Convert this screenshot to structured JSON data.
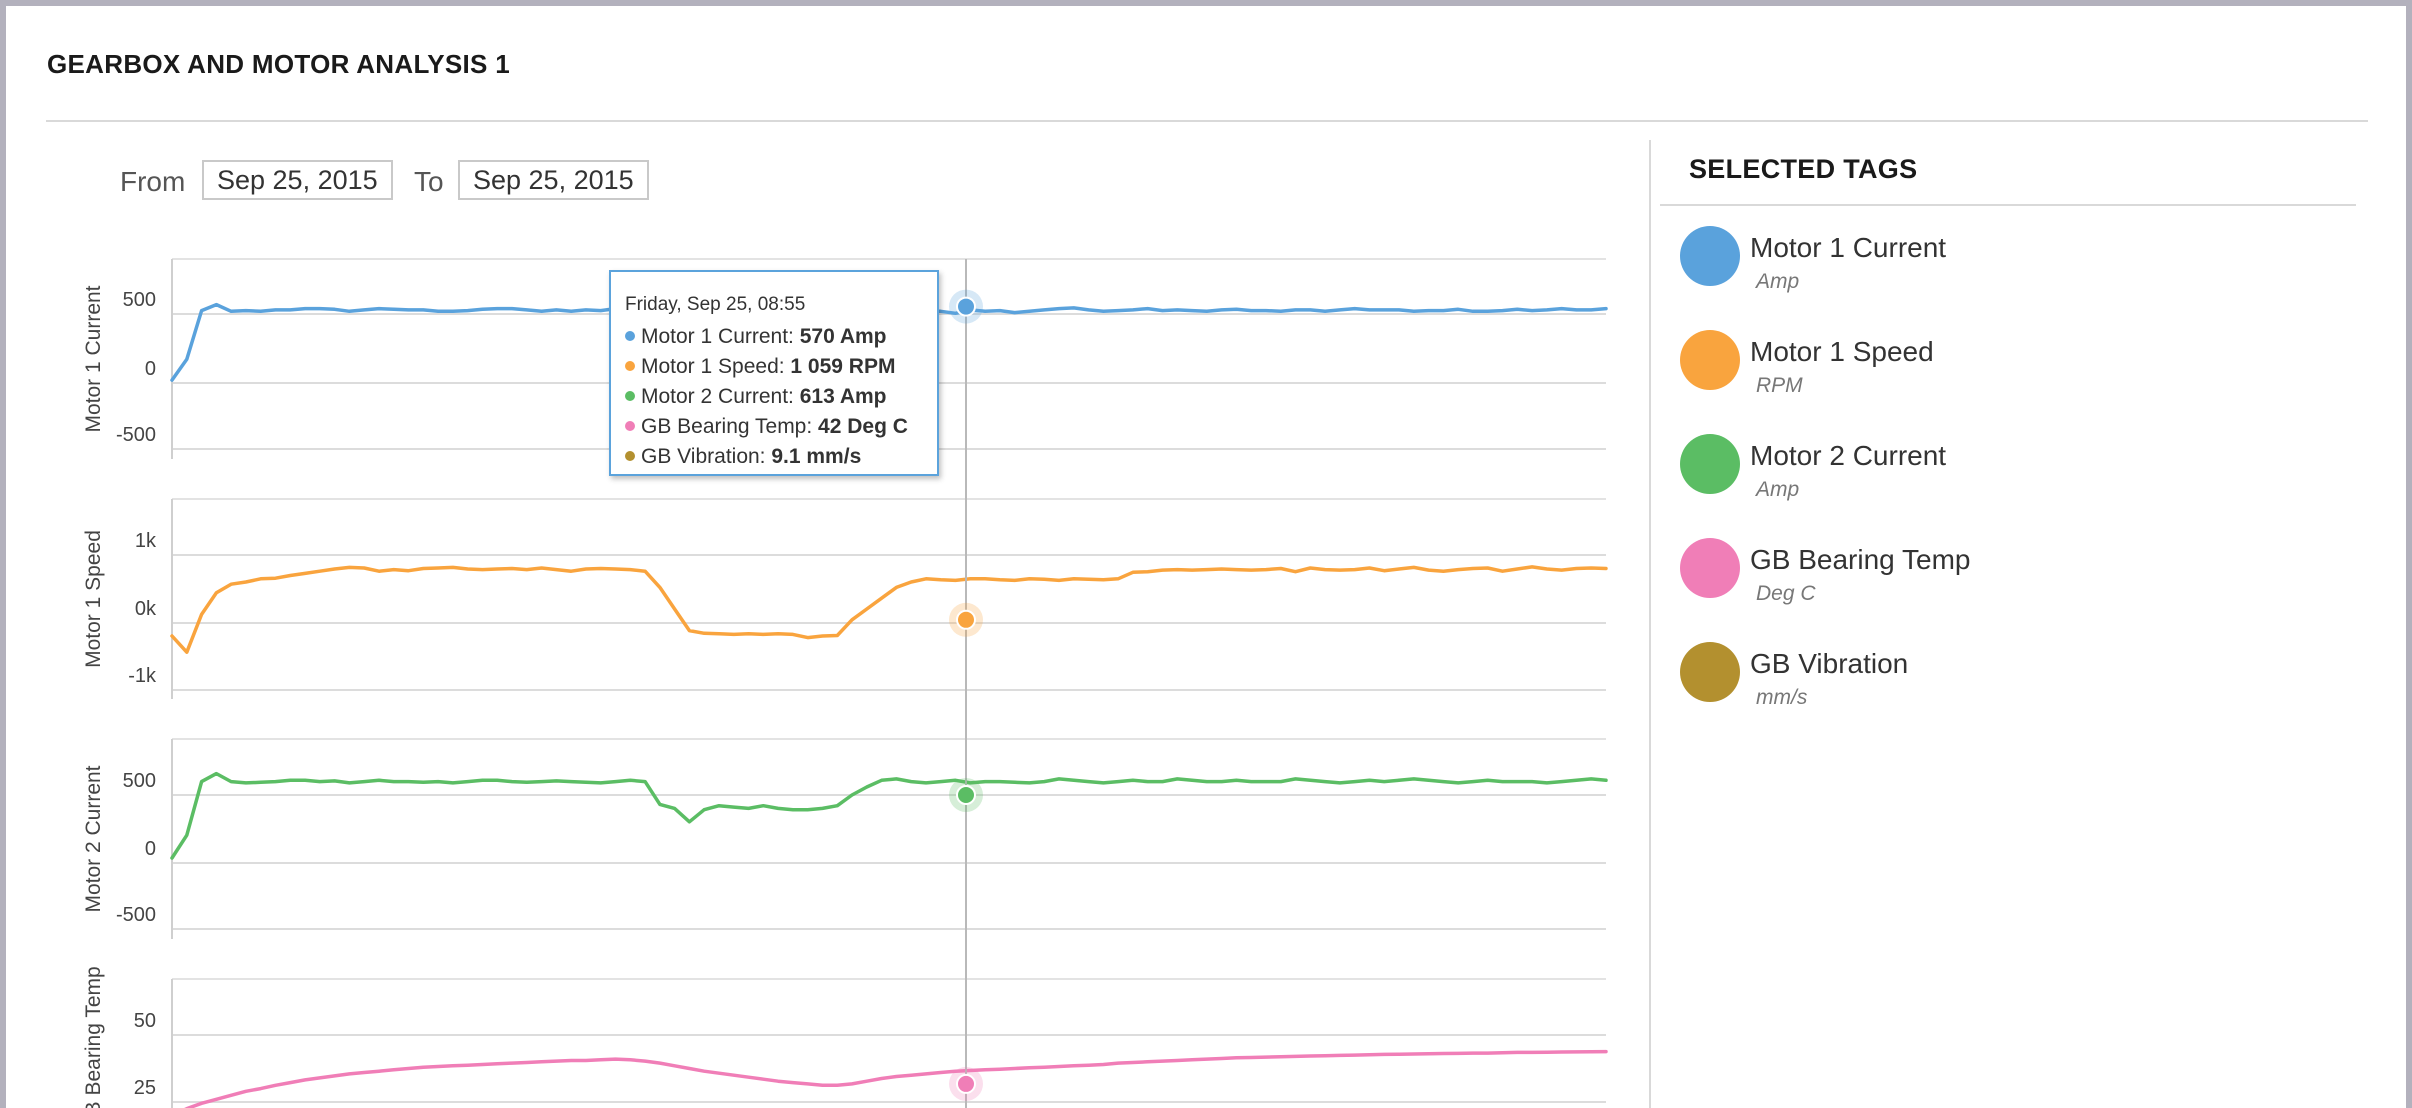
{
  "page": {
    "title": "GEARBOX AND MOTOR ANALYSIS 1"
  },
  "date_range": {
    "from_label": "From",
    "from_value": "Sep 25, 2015",
    "to_label": "To",
    "to_value": "Sep 25, 2015"
  },
  "tooltip": {
    "date": "Friday, Sep 25, 08:55",
    "rows": [
      {
        "label": "Motor 1 Current: ",
        "value": "570 Amp",
        "color": "#5aa2dc"
      },
      {
        "label": "Motor 1 Speed: ",
        "value": "1 059 RPM",
        "color": "#f9a43e"
      },
      {
        "label": "Motor 2 Current: ",
        "value": "613 Amp",
        "color": "#5bbd64"
      },
      {
        "label": "GB Bearing Temp: ",
        "value": "42 Deg C",
        "color": "#f07eb7"
      },
      {
        "label": "GB Vibration: ",
        "value": "9.1 mm/s",
        "color": "#b3902f"
      }
    ]
  },
  "selected_tags": {
    "title": "SELECTED TAGS",
    "items": [
      {
        "name": "Motor 1 Current",
        "unit": "Amp",
        "color": "#5aa2dc"
      },
      {
        "name": "Motor 1 Speed",
        "unit": "RPM",
        "color": "#f9a43e"
      },
      {
        "name": "Motor 2 Current",
        "unit": "Amp",
        "color": "#5bbd64"
      },
      {
        "name": "GB Bearing Temp",
        "unit": "Deg C",
        "color": "#f07eb7"
      },
      {
        "name": "GB Vibration",
        "unit": "mm/s",
        "color": "#b3902f"
      }
    ]
  },
  "chart_data": [
    {
      "type": "line",
      "ylabel": "Motor 1 Current",
      "color": "#5aa2dc",
      "ylim": [
        -500,
        500
      ],
      "yticks": [
        "500",
        "0",
        "-500"
      ],
      "crosshair_index": 46,
      "values": [
        10,
        165,
        525,
        570,
        520,
        525,
        520,
        530,
        530,
        540,
        540,
        535,
        520,
        530,
        540,
        535,
        530,
        530,
        520,
        520,
        525,
        535,
        540,
        540,
        530,
        520,
        530,
        520,
        530,
        525,
        540,
        530,
        525,
        520,
        530,
        535,
        545,
        545,
        540,
        530,
        525,
        520,
        540,
        570,
        560,
        540,
        555,
        525,
        520,
        525,
        530,
        520,
        520,
        505,
        530,
        520,
        525,
        510,
        520,
        530,
        540,
        545,
        530,
        520,
        525,
        530,
        540,
        525,
        530,
        525,
        520,
        530,
        535,
        525,
        525,
        520,
        530,
        530,
        520,
        530,
        540,
        530,
        530,
        530,
        520,
        525,
        525,
        535,
        520,
        520,
        525,
        535,
        525,
        530,
        540,
        530,
        530,
        540
      ]
    },
    {
      "type": "line",
      "ylabel": "Motor 1 Speed",
      "color": "#f9a43e",
      "ylim": [
        -1000,
        1500
      ],
      "yticks": [
        "1k",
        "0k",
        "-1k"
      ],
      "crosshair_index": 46,
      "values": [
        0,
        -300,
        400,
        800,
        960,
        1000,
        1060,
        1070,
        1120,
        1160,
        1200,
        1240,
        1270,
        1260,
        1200,
        1230,
        1210,
        1250,
        1260,
        1270,
        1240,
        1230,
        1240,
        1250,
        1230,
        1260,
        1230,
        1200,
        1240,
        1250,
        1240,
        1230,
        1200,
        900,
        500,
        100,
        50,
        40,
        30,
        40,
        30,
        40,
        30,
        -30,
        0,
        10,
        300,
        500,
        700,
        900,
        1000,
        1060,
        1040,
        1030,
        1060,
        1060,
        1040,
        1030,
        1060,
        1050,
        1030,
        1060,
        1050,
        1040,
        1060,
        1180,
        1190,
        1220,
        1230,
        1220,
        1230,
        1240,
        1230,
        1220,
        1230,
        1250,
        1190,
        1260,
        1230,
        1220,
        1230,
        1260,
        1210,
        1240,
        1270,
        1220,
        1200,
        1230,
        1250,
        1260,
        1200,
        1240,
        1280,
        1240,
        1220,
        1250,
        1260,
        1250
      ]
    },
    {
      "type": "line",
      "ylabel": "Motor 2 Current",
      "color": "#5bbd64",
      "ylim": [
        -500,
        500
      ],
      "yticks": [
        "500",
        "0",
        "-500"
      ],
      "crosshair_index": 46,
      "values": [
        30,
        200,
        600,
        660,
        600,
        590,
        595,
        600,
        610,
        610,
        600,
        605,
        590,
        600,
        610,
        600,
        600,
        595,
        600,
        590,
        600,
        610,
        610,
        600,
        595,
        600,
        605,
        600,
        595,
        590,
        600,
        610,
        600,
        430,
        400,
        300,
        390,
        420,
        410,
        400,
        420,
        400,
        390,
        390,
        400,
        420,
        500,
        560,
        610,
        620,
        600,
        590,
        600,
        610,
        590,
        600,
        600,
        595,
        590,
        600,
        620,
        610,
        600,
        590,
        600,
        610,
        600,
        600,
        620,
        610,
        600,
        600,
        610,
        600,
        600,
        600,
        620,
        610,
        600,
        590,
        600,
        610,
        600,
        610,
        620,
        610,
        600,
        590,
        600,
        610,
        600,
        600,
        600,
        590,
        600,
        610,
        620,
        610
      ]
    },
    {
      "type": "line",
      "ylabel": "GB Bearing Temp",
      "color": "#f07eb7",
      "ylim": [
        25,
        75
      ],
      "yticks": [
        "50",
        "25"
      ],
      "crosshair_index": 46,
      "values": [
        15,
        20,
        24,
        27,
        30,
        33,
        35,
        37.5,
        39.5,
        41.5,
        43,
        44.5,
        46,
        47,
        48,
        49,
        50,
        51,
        51.5,
        52,
        52.5,
        53,
        53.5,
        54,
        54.5,
        55,
        55.5,
        56,
        56,
        56.5,
        57,
        56.5,
        55.5,
        54,
        52,
        50,
        48,
        46.5,
        45,
        43.5,
        42,
        40.5,
        39.5,
        38.5,
        37.5,
        37.5,
        38.5,
        40.5,
        42.5,
        44,
        45,
        46,
        47,
        48,
        48.5,
        49,
        49.5,
        50,
        50.5,
        51,
        51.5,
        52,
        52.5,
        53,
        54,
        54.5,
        55,
        55.5,
        56,
        56.5,
        57,
        57.5,
        58,
        58.2,
        58.5,
        58.8,
        59,
        59.3,
        59.5,
        59.8,
        60,
        60.2,
        60.5,
        60.7,
        60.8,
        61,
        61.2,
        61.3,
        61.5,
        61.5,
        61.8,
        62,
        62,
        62.2,
        62.3,
        62.4,
        62.5,
        62.6
      ]
    }
  ]
}
